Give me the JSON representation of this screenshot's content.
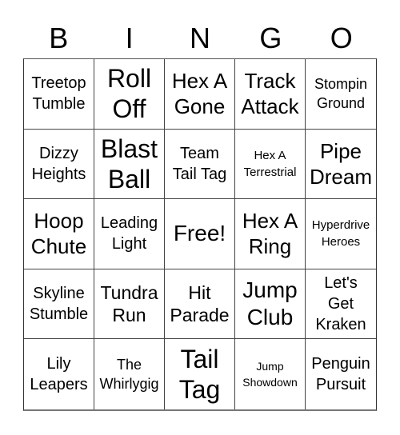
{
  "header": {
    "letters": [
      "B",
      "I",
      "N",
      "G",
      "O"
    ]
  },
  "grid": {
    "rows": [
      [
        {
          "text": "Treetop\nTumble",
          "size": "sm"
        },
        {
          "text": "Roll\nOff",
          "size": "xl"
        },
        {
          "text": "Hex A\nGone",
          "size": "l2"
        },
        {
          "text": "Track\nAttack",
          "size": "l2"
        },
        {
          "text": "Stompin\nGround",
          "size": "xs"
        }
      ],
      [
        {
          "text": "Dizzy\nHeights",
          "size": "sm"
        },
        {
          "text": "Blast\nBall",
          "size": "xl"
        },
        {
          "text": "Team\nTail Tag",
          "size": "sm"
        },
        {
          "text": "Hex A\nTerrestrial",
          "size": "xxs"
        },
        {
          "text": "Pipe\nDream",
          "size": "l2"
        }
      ],
      [
        {
          "text": "Hoop\nChute",
          "size": "l2"
        },
        {
          "text": "Leading\nLight",
          "size": "sm"
        },
        {
          "text": "Free!",
          "size": "lg"
        },
        {
          "text": "Hex A\nRing",
          "size": "l2"
        },
        {
          "text": "Hyperdrive\nHeroes",
          "size": "xxs"
        }
      ],
      [
        {
          "text": "Skyline\nStumble",
          "size": "sm"
        },
        {
          "text": "Tundra\nRun",
          "size": "md"
        },
        {
          "text": "Hit\nParade",
          "size": "md"
        },
        {
          "text": "Jump\nClub",
          "size": "lg"
        },
        {
          "text": "Let's\nGet\nKraken",
          "size": "sm"
        }
      ],
      [
        {
          "text": "Lily\nLeapers",
          "size": "sm"
        },
        {
          "text": "The\nWhirlygig",
          "size": "xs"
        },
        {
          "text": "Tail\nTag",
          "size": "xl"
        },
        {
          "text": "Jump\nShowdown",
          "size": "tiny"
        },
        {
          "text": "Penguin\nPursuit",
          "size": "sm"
        }
      ]
    ]
  }
}
